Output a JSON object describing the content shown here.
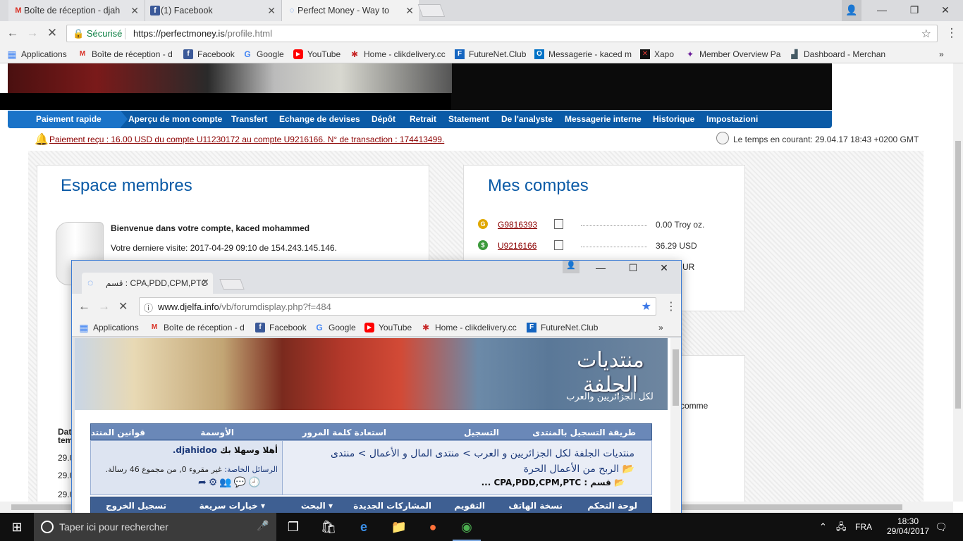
{
  "main_window": {
    "tabs": [
      {
        "title": "Boîte de réception - djah",
        "favicon": "gmail-icon"
      },
      {
        "title": "(1) Facebook",
        "favicon": "facebook-icon"
      },
      {
        "title": "Perfect Money - Way to",
        "favicon": "loading-icon"
      }
    ],
    "omnibox": {
      "security_label": "Sécurisé",
      "url_scheme_host": "https://perfectmoney.is",
      "url_path": "/profile.html"
    },
    "bookmarks": [
      {
        "label": "Applications",
        "icon": "apps-icon",
        "color": "#4285f4"
      },
      {
        "label": "Boîte de réception - d",
        "icon": "gmail-icon",
        "color": "#d93025"
      },
      {
        "label": "Facebook",
        "icon": "facebook-icon",
        "color": "#3b5998"
      },
      {
        "label": "Google",
        "icon": "google-icon",
        "color": "#4285f4"
      },
      {
        "label": "YouTube",
        "icon": "youtube-icon",
        "color": "#ff0000"
      },
      {
        "label": "Home - clikdelivery.cc",
        "icon": "clikdelivery-icon",
        "color": "#c62828"
      },
      {
        "label": "FutureNet.Club",
        "icon": "futurenet-icon",
        "color": "#1565c0"
      },
      {
        "label": "Messagerie - kaced m",
        "icon": "outlook-icon",
        "color": "#0072c6"
      },
      {
        "label": "Xapo",
        "icon": "xapo-icon",
        "color": "#111111"
      },
      {
        "label": "Member Overview Pa",
        "icon": "member-icon",
        "color": "#6a1b9a"
      },
      {
        "label": "Dashboard - Merchan",
        "icon": "dashboard-icon",
        "color": "#455a64"
      }
    ]
  },
  "site": {
    "nav": [
      "Paiement rapide",
      "Aperçu de mon compte",
      "Transfert",
      "Echange de devises",
      "Dépôt",
      "Retrait",
      "Statement",
      "De l'analyste",
      "Messagerie interne",
      "Historique",
      "Impostazioni"
    ],
    "notice": "Paiement reçu : 16.00 USD du compte U11230172 au compte U9216166. N° de transaction : 174413499.",
    "time": "Le temps en courant: 29.04.17 18:43 +0200 GMT",
    "members": {
      "title": "Espace membres",
      "welcome": "Bienvenue dans votre compte, kaced mohammed",
      "last_visit": "Votre derniere visite: 2017-04-29 09:10 de 154.243.145.146.",
      "side_label_1": "Dat",
      "side_label_2": "tem",
      "side_rows": [
        "29.0",
        "29.0",
        "29.0",
        "29.0"
      ]
    },
    "accounts": {
      "title": "Mes comptes",
      "rows": [
        {
          "number": "G9816393",
          "balance": "0.00 Troy oz.",
          "coin_color": "#e0a800",
          "coin_glyph": "G"
        },
        {
          "number": "U9216166",
          "balance": "36.29 USD",
          "coin_color": "#3c9a3c",
          "coin_glyph": "$"
        }
      ],
      "partial_currency": "UR",
      "partial_text": "comme"
    }
  },
  "popup": {
    "tab_title": "قسم : CPA,PDD,CPM,PTC",
    "url_host": "www.djelfa.info",
    "url_path": "/vb/forumdisplay.php?f=484",
    "bookmarks": [
      "Applications",
      "Boîte de réception - d",
      "Facebook",
      "Google",
      "YouTube",
      "Home - clikdelivery.cc",
      "FutureNet.Club"
    ],
    "forum": {
      "nav": [
        "طريقة التسجيل بالمنتدى",
        "التسجيل",
        "استعادة كلمة المرور",
        "الأوسمة",
        "قوانين المنتدى"
      ],
      "breadcrumb_1": "منتديات الجلفة لكل الجزائريين و العرب > منتدى المال و الأعمال > منتدى",
      "breadcrumb_2": "الربح من الأعمال الحرة",
      "section": "قسم : CPA,PDD,CPM,PTC ...",
      "welcome_prefix": "أهلا وسهلا بك",
      "username": "djahidoo.",
      "private_msgs_label": "الرسائل الخاصة:",
      "private_msgs_value": "غير مقروء 0, من مجموع 46 رسالة.",
      "nav2": [
        "لوحة التحكم",
        "نسخة الهاتف",
        "التقويم",
        "المشاركات الجديدة",
        "البحث",
        "خيارات سريعة",
        "تسجيل الخروج"
      ]
    }
  },
  "taskbar": {
    "search_placeholder": "Taper ici pour rechercher",
    "language": "FRA",
    "time": "18:30",
    "date": "29/04/2017"
  }
}
